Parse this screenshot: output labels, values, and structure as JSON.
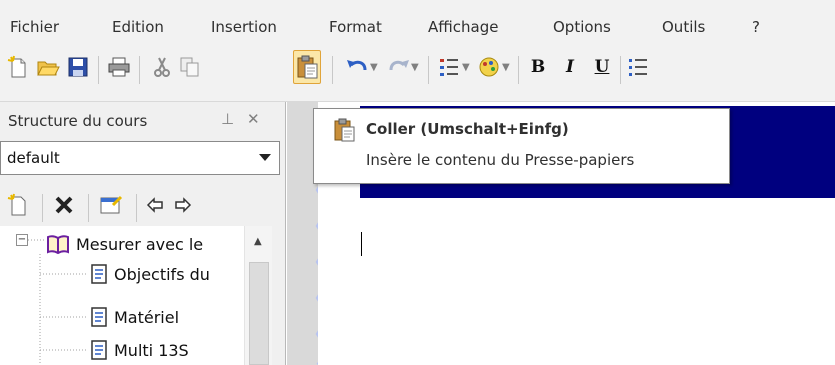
{
  "menu": {
    "items": [
      "Fichier",
      "Edition",
      "Insertion",
      "Format",
      "Affichage",
      "Options",
      "Outils",
      "?"
    ]
  },
  "toolbar": {
    "buttons": [
      "new-document",
      "open-folder",
      "save",
      "print",
      "cut",
      "copy",
      "paste",
      "undo",
      "redo",
      "numbered-list",
      "color",
      "bold",
      "italic",
      "underline",
      "bullet-list"
    ],
    "bold_label": "B",
    "italic_label": "I",
    "underline_label": "U",
    "active_button": "paste"
  },
  "tooltip": {
    "title": "Coller (Umschalt+Einfg)",
    "description": "Insère le contenu du Presse-papiers"
  },
  "left_pane": {
    "title": "Structure du cours",
    "pin_glyph": "⊥",
    "close_glyph": "✕",
    "combo_value": "default",
    "tree": {
      "root": "Mesurer avec le",
      "expander": "−",
      "children": [
        "Objectifs du",
        "Matériel",
        "Multi 13S"
      ]
    }
  },
  "colors": {
    "doc_header": "#00007f",
    "zigzag": "#b8c4f0",
    "pressed_button": "#fbe7a8"
  }
}
